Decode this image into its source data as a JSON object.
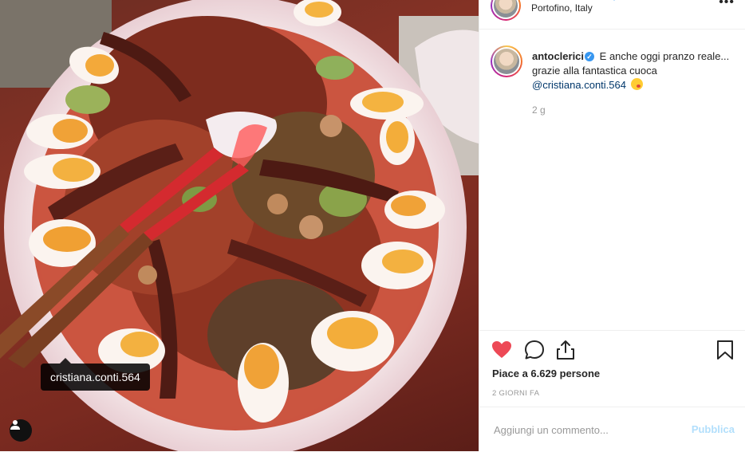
{
  "photo": {
    "tag_label": "cristiana.conti.564",
    "user_tag_icon": "user-silhouette-icon"
  },
  "header": {
    "location": "Portofino, Italy",
    "more_icon": "ellipsis-icon",
    "more_glyph": "•••"
  },
  "caption": {
    "username": "antoclerici",
    "verified_glyph": "✓",
    "text": "E anche oggi pranzo reale... grazie alla fantastica cuoca",
    "mention": "@cristiana.conti.564",
    "time": "2 g"
  },
  "actions": {
    "like_icon": "heart-icon",
    "comment_icon": "comment-bubble-icon",
    "share_icon": "share-icon",
    "save_icon": "bookmark-icon",
    "likes_text": "Piace a 6.629 persone",
    "date": "2 GIORNI FA"
  },
  "add_comment": {
    "placeholder": "Aggiungi un commento...",
    "publish_label": "Pubblica"
  },
  "colors": {
    "like_red": "#ed4956",
    "link_blue": "#00376b",
    "publish_disabled": "#b2dffc",
    "verified_blue": "#3897f0"
  }
}
